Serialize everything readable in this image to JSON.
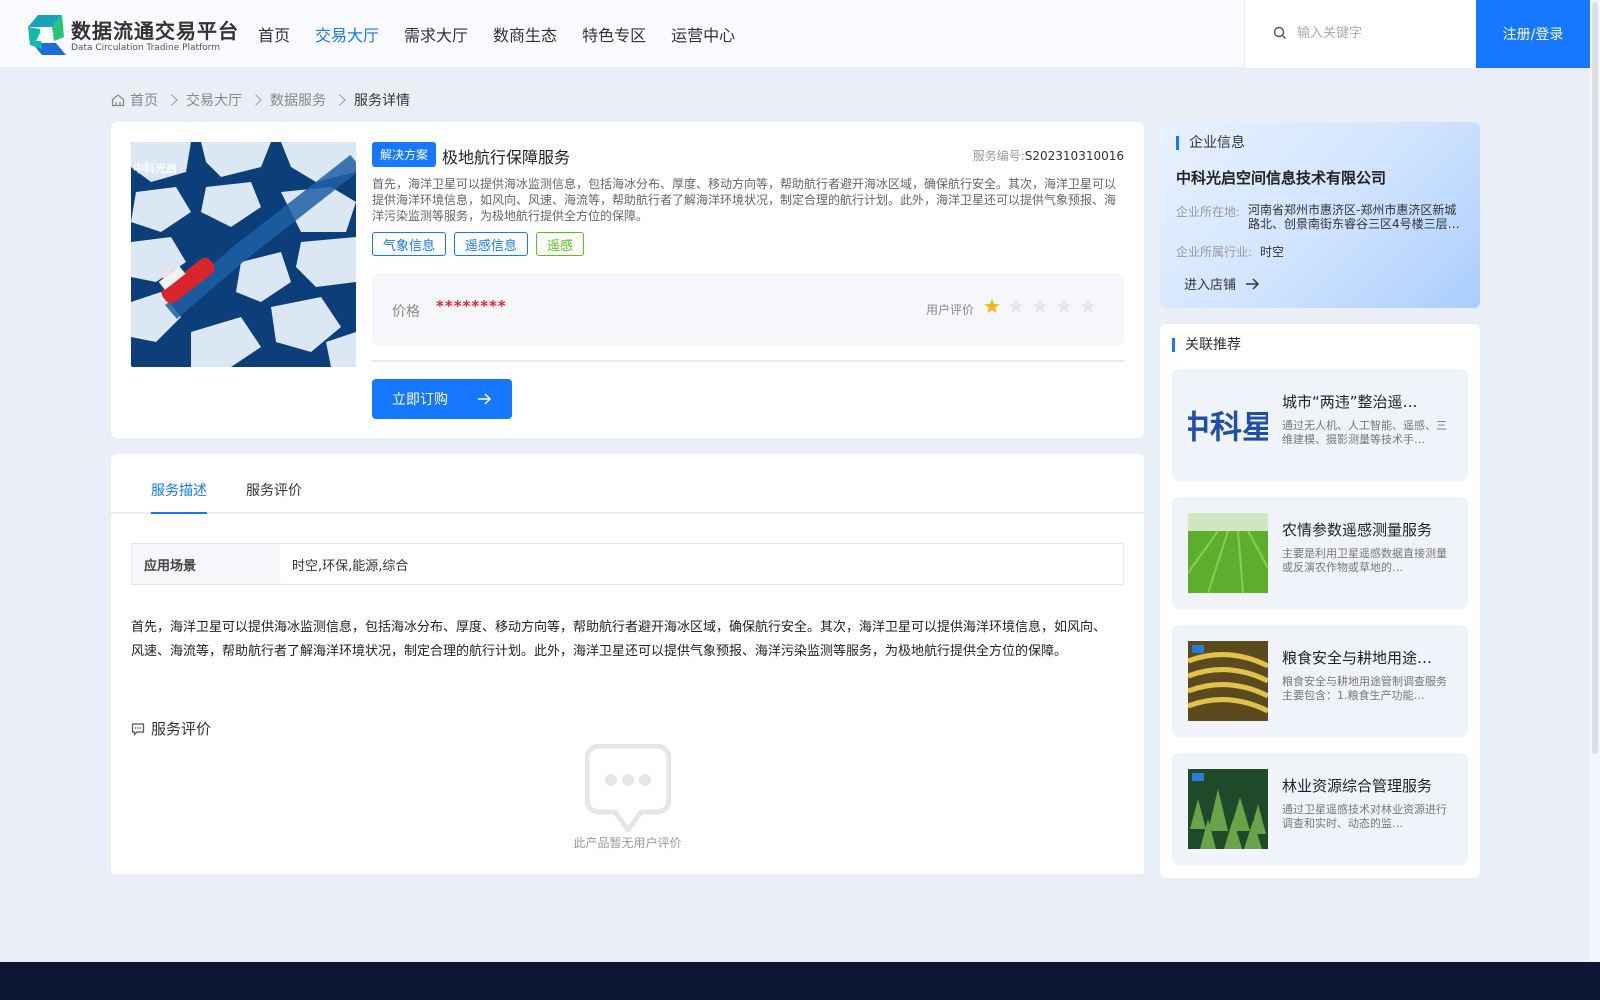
{
  "brand": {
    "title": "数据流通交易平台",
    "subtitle": "Data Circulation Tradine Platform"
  },
  "nav": [
    {
      "label": "首页",
      "active": false
    },
    {
      "label": "交易大厅",
      "active": true
    },
    {
      "label": "需求大厅",
      "active": false
    },
    {
      "label": "数商生态",
      "active": false
    },
    {
      "label": "特色专区",
      "active": false
    },
    {
      "label": "运营中心",
      "active": false
    }
  ],
  "search": {
    "placeholder": "输入关键字",
    "value": ""
  },
  "login_label": "注册/登录",
  "breadcrumb": [
    "首页",
    "交易大厅",
    "数据服务",
    "服务详情"
  ],
  "product": {
    "image_text": "中科光启",
    "type_badge": "解决方案",
    "title": "极地航行保障服务",
    "id_label": "服务编号:",
    "id_value": "S202310310016",
    "summary": "首先，海洋卫星可以提供海冰监测信息，包括海冰分布、厚度、移动方向等，帮助航行者避开海冰区域，确保航行安全。其次，海洋卫星可以提供海洋环境信息，如风向、风速、海流等，帮助航行者了解海洋环境状况，制定合理的航行计划。此外，海洋卫星还可以提供气象预报、海洋污染监测等服务，为极地航行提供全方位的保障。",
    "tags": [
      {
        "label": "气象信息",
        "color": "#1677ff"
      },
      {
        "label": "遥感信息",
        "color": "#1677ff"
      },
      {
        "label": "遥感",
        "color": "#52c41a"
      }
    ],
    "price_label": "价格",
    "price_value": "********",
    "rating_label": "用户评价",
    "rating": 1,
    "rating_max": 5,
    "buy_label": "立即订购"
  },
  "detail": {
    "tabs": [
      {
        "label": "服务描述",
        "active": true
      },
      {
        "label": "服务评价",
        "active": false
      }
    ],
    "scene_key": "应用场景",
    "scene_value": "时空,环保,能源,综合",
    "body": "首先，海洋卫星可以提供海冰监测信息，包括海冰分布、厚度、移动方向等，帮助航行者避开海冰区域，确保航行安全。其次，海洋卫星可以提供海洋环境信息，如风向、风速、海流等，帮助航行者了解海洋环境状况，制定合理的航行计划。此外，海洋卫星还可以提供气象预报、海洋污染监测等服务，为极地航行提供全方位的保障。",
    "review_title": "服务评价",
    "empty_text": "此产品暂无用户评价"
  },
  "company": {
    "section_title": "企业信息",
    "name": "中科光启空间信息技术有限公司",
    "location_label": "企业所在地:",
    "location_value": "河南省郑州市惠济区-郑州市惠济区新城路北、创景南街东睿谷三区4号楼三层…",
    "industry_label": "企业所属行业:",
    "industry_value": "时空",
    "enter_label": "进入店铺"
  },
  "recommend": {
    "section_title": "关联推荐",
    "logo_text": "中科星",
    "items": [
      {
        "name": "城市“两违”整治遥…",
        "desc": "通过无人机、人工智能、遥感、三维建模、摄影测量等技术手…"
      },
      {
        "name": "农情参数遥感测量服务",
        "desc": "主要是利用卫星遥感数据直接测量或反演农作物或草地的…"
      },
      {
        "name": "粮食安全与耕地用途…",
        "desc": "粮食安全与耕地用途管制调查服务主要包含：1.粮食生产功能…"
      },
      {
        "name": "林业资源综合管理服务",
        "desc": "通过卫星遥感技术对林业资源进行调查和实时、动态的监…"
      }
    ]
  },
  "colors": {
    "accent": "#1677ff",
    "price": "#f5222d",
    "star": "#f5b41b",
    "footer": "#0e1635",
    "tag_green": "#52c41a"
  },
  "icons": [
    "logo-mark-icon",
    "search-icon",
    "home-icon",
    "chevron-right-icon",
    "star-icon",
    "arrow-right-icon",
    "comment-icon",
    "chat-bubble-icon"
  ]
}
